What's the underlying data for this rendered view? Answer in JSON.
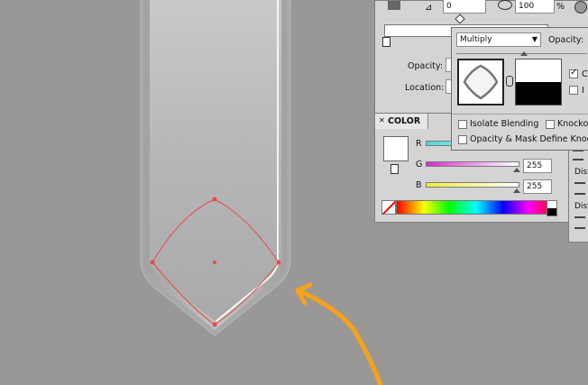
{
  "gradient_panel": {
    "angle_value": "0",
    "opacity_value": "100",
    "opacity_unit": "%",
    "opacity_label": "Opacity:",
    "location_label": "Location:"
  },
  "transparency_panel": {
    "blend_mode": "Multiply",
    "opacity_label": "Opacity:",
    "clip_label": "C",
    "invert_label": "I",
    "clip_checked": true,
    "invert_checked": false,
    "isolate_blending_label": "Isolate Blending",
    "knockout_label": "Knocko",
    "opacity_mask_label": "Opacity & Mask Define Knock"
  },
  "color_panel": {
    "tab_label": "COLOR",
    "channels": [
      {
        "label": "R",
        "value": "",
        "color": "#49d7db"
      },
      {
        "label": "G",
        "value": "255",
        "color": "#e033d8"
      },
      {
        "label": "B",
        "value": "255",
        "color": "#f0f038"
      }
    ]
  },
  "side_panel": {
    "labels": [
      "Dist",
      "Dist"
    ]
  },
  "colors": {
    "canvas": "#9a9896",
    "panel": "#d4d4d4",
    "arrow": "#f5a21c",
    "path": "#e84a4a"
  }
}
